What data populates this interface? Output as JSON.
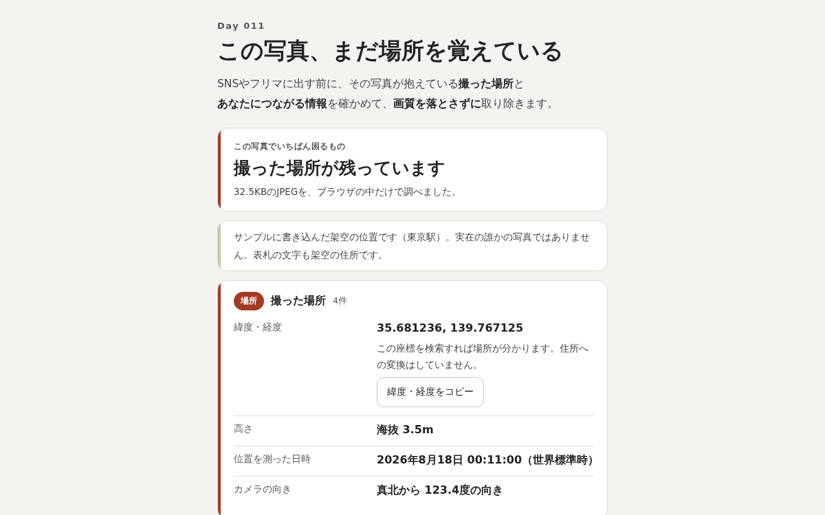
{
  "eyebrow": "Day 011",
  "title": "この写真、まだ場所を覚えている",
  "lede": [
    "SNSやフリマに出す前に、その写真が抱えている**撮った場所**と",
    "**あなたにつながる情報**を確かめて、**画質を落とさずに**取り除きます。"
  ],
  "cards": [
    {
      "kind": "verdict",
      "eyebrow": "この写真でいちばん困るもの",
      "heading": "撮った場所が残っています",
      "detail": "32.5KBのJPEGを、ブラウザの中だけで調べました。",
      "color": "#a33a22"
    },
    {
      "kind": "note",
      "text": "サンプルに書き込んだ架空の位置です（東京駅）。実在の誰かの写真ではありません。表札の文字も架空の住所です。",
      "color": "#c9c5b4"
    },
    {
      "kind": "group",
      "badge": "場所",
      "heading": "撮った場所",
      "count": "4件",
      "color": "#a33a22",
      "rows": [
        {
          "label": "緯度・経度",
          "value": "35.681236, 139.767125",
          "note": "この座標を検索すれば場所が分かります。住所への変換はしていません。",
          "button": "緯度・経度をコピー"
        },
        {
          "label": "高さ",
          "value": "海抜 3.5m"
        },
        {
          "label": "位置を測った日時",
          "value": "2026年8月18日 00:11:00（世界標準時）"
        },
        {
          "label": "カメラの向き",
          "value": "真北から 123.4度の向き"
        }
      ]
    }
  ]
}
